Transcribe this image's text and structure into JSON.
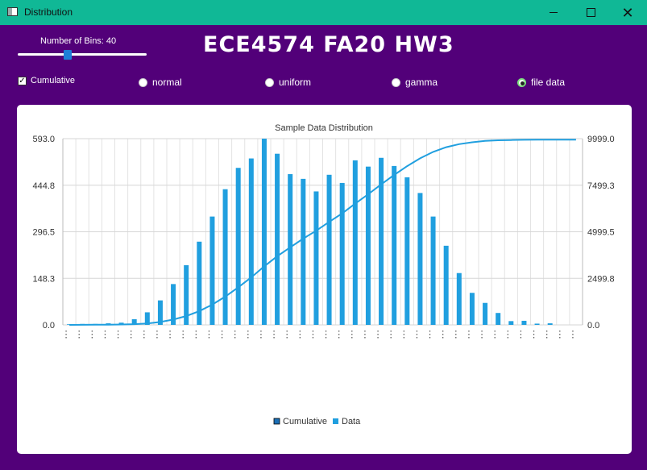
{
  "window": {
    "title": "Distribution",
    "minimize_icon": "minimize-icon",
    "maximize_icon": "maximize-icon",
    "close_icon": "close-icon"
  },
  "controls": {
    "bins_label": "Number of Bins: 40",
    "bins_value": 40,
    "bins_fraction": 0.38,
    "heading": "ECE4574 FA20 HW3",
    "cumulative_label": "Cumulative",
    "cumulative_checked": true,
    "distributions": [
      {
        "label": "normal",
        "checked": false
      },
      {
        "label": "uniform",
        "checked": false
      },
      {
        "label": "gamma",
        "checked": false
      },
      {
        "label": "file data",
        "checked": true
      }
    ]
  },
  "colors": {
    "window_bg": "#520079",
    "titlebar": "#10b896",
    "bar": "#209fdf",
    "line": "#209fdf",
    "slider_handle": "#1e7fd8"
  },
  "chart_data": {
    "type": "bar",
    "title": "Sample Data Distribution",
    "left_axis": {
      "min": 0,
      "max": 593.0,
      "ticks": [
        "593.0",
        "444.8",
        "296.5",
        "148.3",
        "0.0"
      ]
    },
    "right_axis": {
      "min": 0,
      "max": 9999.0,
      "ticks": [
        "9999.0",
        "7499.3",
        "4999.5",
        "2499.8",
        "0.0"
      ]
    },
    "grid": true,
    "legend_position": "bottom",
    "legend": [
      "Cumulative",
      "Data"
    ],
    "series": [
      {
        "name": "Data",
        "type": "bar",
        "values": [
          2,
          3,
          3,
          5,
          7,
          18,
          40,
          78,
          130,
          190,
          265,
          345,
          432,
          500,
          530,
          593,
          545,
          480,
          465,
          425,
          478,
          452,
          524,
          504,
          532,
          506,
          470,
          420,
          345,
          252,
          165,
          102,
          70,
          38,
          12,
          13,
          4,
          5,
          0,
          0
        ]
      },
      {
        "name": "Cumulative",
        "type": "line",
        "values": [
          2,
          5,
          8,
          13,
          20,
          38,
          78,
          156,
          286,
          476,
          741,
          1086,
          1518,
          2018,
          2548,
          3141,
          3686,
          4166,
          4631,
          5056,
          5534,
          5986,
          6510,
          7014,
          7546,
          8052,
          8522,
          8942,
          9287,
          9539,
          9704,
          9806,
          9876,
          9914,
          9926,
          9939,
          9943,
          9948,
          9948,
          9948
        ]
      }
    ]
  }
}
